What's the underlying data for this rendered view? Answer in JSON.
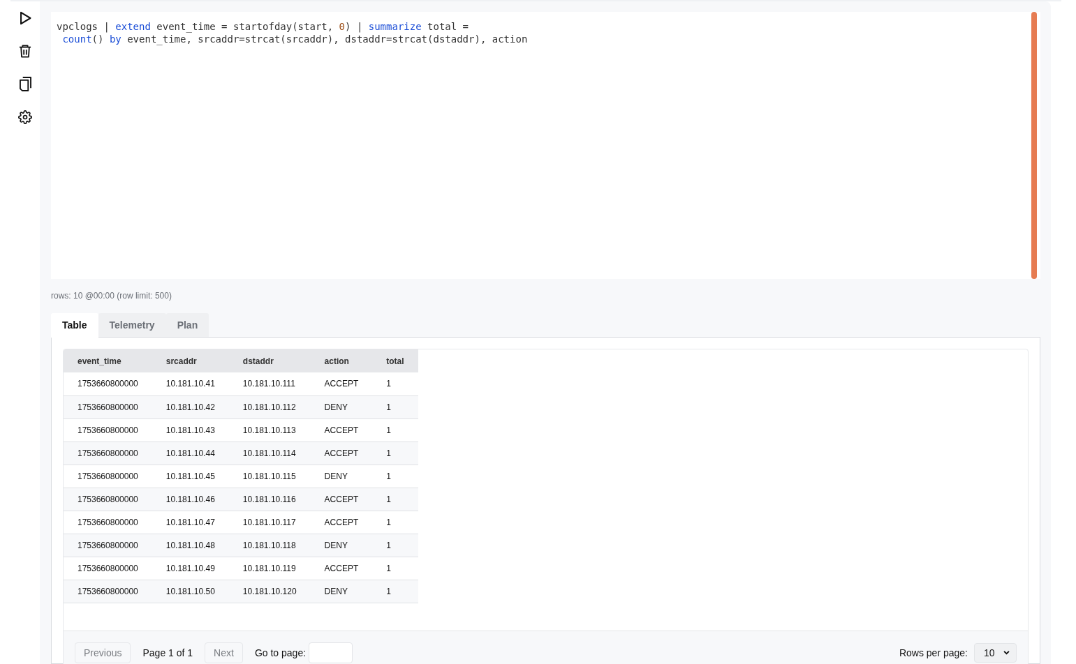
{
  "editor": {
    "lines": [
      [
        {
          "text": "vpclogs | ",
          "kind": "plain"
        },
        {
          "text": "extend",
          "kind": "keyword"
        },
        {
          "text": " event_time = startofday(start, ",
          "kind": "plain"
        },
        {
          "text": "0",
          "kind": "number"
        },
        {
          "text": ") | ",
          "kind": "plain"
        },
        {
          "text": "summarize",
          "kind": "keyword"
        },
        {
          "text": " total =",
          "kind": "plain"
        }
      ],
      [
        {
          "text": " count",
          "kind": "keyword"
        },
        {
          "text": "() ",
          "kind": "plain"
        },
        {
          "text": "by",
          "kind": "keyword"
        },
        {
          "text": " event_time, srcaddr=strcat(srcaddr), dstaddr=strcat(dstaddr), action",
          "kind": "plain"
        }
      ]
    ]
  },
  "status": "rows: 10 @00:00 (row limit: 500)",
  "tabs": [
    {
      "label": "Table",
      "selected": true
    },
    {
      "label": "Telemetry",
      "selected": false
    },
    {
      "label": "Plan",
      "selected": false
    }
  ],
  "table": {
    "columns": [
      "event_time",
      "srcaddr",
      "dstaddr",
      "action",
      "total"
    ],
    "rows": [
      [
        "1753660800000",
        "10.181.10.41",
        "10.181.10.111",
        "ACCEPT",
        "1"
      ],
      [
        "1753660800000",
        "10.181.10.42",
        "10.181.10.112",
        "DENY",
        "1"
      ],
      [
        "1753660800000",
        "10.181.10.43",
        "10.181.10.113",
        "ACCEPT",
        "1"
      ],
      [
        "1753660800000",
        "10.181.10.44",
        "10.181.10.114",
        "ACCEPT",
        "1"
      ],
      [
        "1753660800000",
        "10.181.10.45",
        "10.181.10.115",
        "DENY",
        "1"
      ],
      [
        "1753660800000",
        "10.181.10.46",
        "10.181.10.116",
        "ACCEPT",
        "1"
      ],
      [
        "1753660800000",
        "10.181.10.47",
        "10.181.10.117",
        "ACCEPT",
        "1"
      ],
      [
        "1753660800000",
        "10.181.10.48",
        "10.181.10.118",
        "DENY",
        "1"
      ],
      [
        "1753660800000",
        "10.181.10.49",
        "10.181.10.119",
        "ACCEPT",
        "1"
      ],
      [
        "1753660800000",
        "10.181.10.50",
        "10.181.10.120",
        "DENY",
        "1"
      ]
    ]
  },
  "pagination": {
    "previous": {
      "label": "Previous",
      "disabled": true
    },
    "page_info": "Page 1 of 1",
    "next": {
      "label": "Next",
      "disabled": true
    },
    "goto_label": "Go to page:",
    "rows_per_page_label": "Rows per page:",
    "rows_per_page": "10"
  }
}
